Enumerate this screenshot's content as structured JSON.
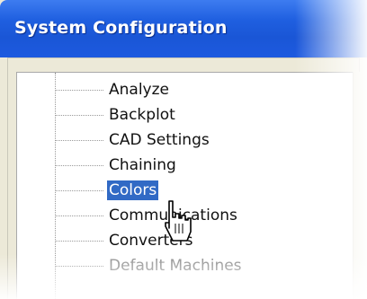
{
  "window": {
    "title": "System Configuration"
  },
  "tree": {
    "items": [
      {
        "label": "Analyze",
        "state": "normal"
      },
      {
        "label": "Backplot",
        "state": "normal"
      },
      {
        "label": "CAD Settings",
        "state": "normal"
      },
      {
        "label": "Chaining",
        "state": "normal"
      },
      {
        "label": "Colors",
        "state": "selected"
      },
      {
        "label": "Communications",
        "state": "normal"
      },
      {
        "label": "Converters",
        "state": "normal"
      },
      {
        "label": "Default Machines",
        "state": "dim"
      }
    ]
  },
  "colors": {
    "titlebar": "#1f5fe0",
    "selection": "#316ac5"
  },
  "icons": {
    "pointer": "hand-cursor-icon"
  }
}
